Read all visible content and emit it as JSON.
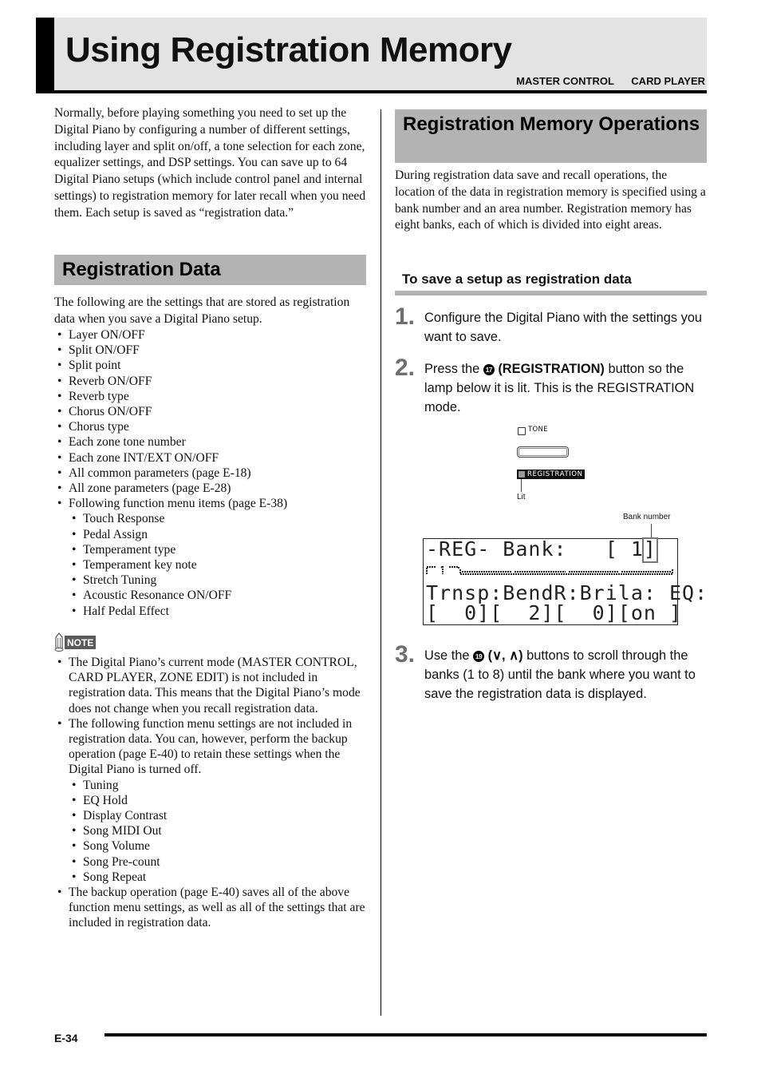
{
  "header": {
    "title": "Using Registration Memory",
    "modes": [
      "MASTER CONTROL",
      "CARD PLAYER"
    ]
  },
  "left": {
    "intro": "Normally, before playing something you need to set up the Digital Piano by configuring a number of different settings, including layer and split on/off, a tone selection for each zone, equalizer settings, and DSP settings. You can save up to 64 Digital Piano setups (which include control panel and internal settings) to registration memory for later recall when you need them. Each setup is saved as “registration data.”",
    "section_title": "Registration Data",
    "section_intro": "The following are the settings that are stored as registration data when you save a Digital Piano setup.",
    "settings": [
      {
        "text": "Layer ON/OFF",
        "level": 1
      },
      {
        "text": "Split ON/OFF",
        "level": 1
      },
      {
        "text": "Split point",
        "level": 1
      },
      {
        "text": "Reverb ON/OFF",
        "level": 1
      },
      {
        "text": "Reverb type",
        "level": 1
      },
      {
        "text": "Chorus ON/OFF",
        "level": 1
      },
      {
        "text": "Chorus type",
        "level": 1
      },
      {
        "text": "Each zone tone number",
        "level": 1
      },
      {
        "text": "Each zone INT/EXT ON/OFF",
        "level": 1
      },
      {
        "text": "All common parameters (page E-18)",
        "level": 1
      },
      {
        "text": "All zone parameters (page E-28)",
        "level": 1
      },
      {
        "text": "Following function menu items (page E-38)",
        "level": 1
      },
      {
        "text": "Touch Response",
        "level": 2
      },
      {
        "text": "Pedal Assign",
        "level": 2
      },
      {
        "text": "Temperament type",
        "level": 2
      },
      {
        "text": "Temperament key note",
        "level": 2
      },
      {
        "text": "Stretch Tuning",
        "level": 2
      },
      {
        "text": "Acoustic Resonance ON/OFF",
        "level": 2
      },
      {
        "text": "Half Pedal Effect",
        "level": 2
      }
    ],
    "note": {
      "label": "NOTE",
      "items": [
        {
          "text": "The Digital Piano’s current mode (MASTER CONTROL, CARD PLAYER, ZONE EDIT) is not included in registration data. This means that the Digital Piano’s mode does not change when you recall registration data.",
          "level": 1
        },
        {
          "text": "The following function menu settings are not included in registration data. You can, however, perform the backup operation (page E-40) to retain these settings when the Digital Piano is turned off.",
          "level": 1
        },
        {
          "text": "Tuning",
          "level": 2
        },
        {
          "text": "EQ Hold",
          "level": 2
        },
        {
          "text": "Display Contrast",
          "level": 2
        },
        {
          "text": "Song MIDI Out",
          "level": 2
        },
        {
          "text": "Song Volume",
          "level": 2
        },
        {
          "text": "Song Pre-count",
          "level": 2
        },
        {
          "text": "Song Repeat",
          "level": 2
        },
        {
          "text": "The backup operation (page E-40) saves all of the above function menu settings, as well as all of the settings that are included in registration data.",
          "level": 1
        }
      ]
    }
  },
  "right": {
    "section_title": "Registration Memory Operations",
    "intro": "During registration data save and recall operations, the location of the data in registration memory is specified using a bank number and an area number. Registration memory has eight banks, each of which is divided into eight areas.",
    "subsection_title": "To save a setup as registration data",
    "steps": [
      {
        "num": "1.",
        "parts": [
          {
            "t": "Configure the Digital Piano with the settings you want to save."
          }
        ]
      },
      {
        "num": "2.",
        "parts": [
          {
            "t": "Press the "
          },
          {
            "circled": "17"
          },
          {
            "t": " (REGISTRATION)",
            "bold": true
          },
          {
            "t": " button so the lamp below it is lit. This is the REGISTRATION mode."
          }
        ]
      },
      {
        "num": "3.",
        "parts": [
          {
            "t": "Use the "
          },
          {
            "circled": "19"
          },
          {
            "t": " (∨, ∧)",
            "bold": true
          },
          {
            "t": " buttons to scroll through the banks (1 to 8) until the bank where you want to save the registration data is displayed."
          }
        ]
      }
    ],
    "illustration": {
      "tone_label": "TONE",
      "registration_label": "REGISTRATION",
      "lit_label": "Lit",
      "bank_number_label": "Bank number",
      "lcd": {
        "row1": "-REG- Bank:   [ 1]",
        "row3": "Trnsp:BendR:Brila: EQ:",
        "row4": "[  0][  2][  0][on ]",
        "bank_value": "1"
      }
    }
  },
  "footer": {
    "page_number": "E-34"
  }
}
